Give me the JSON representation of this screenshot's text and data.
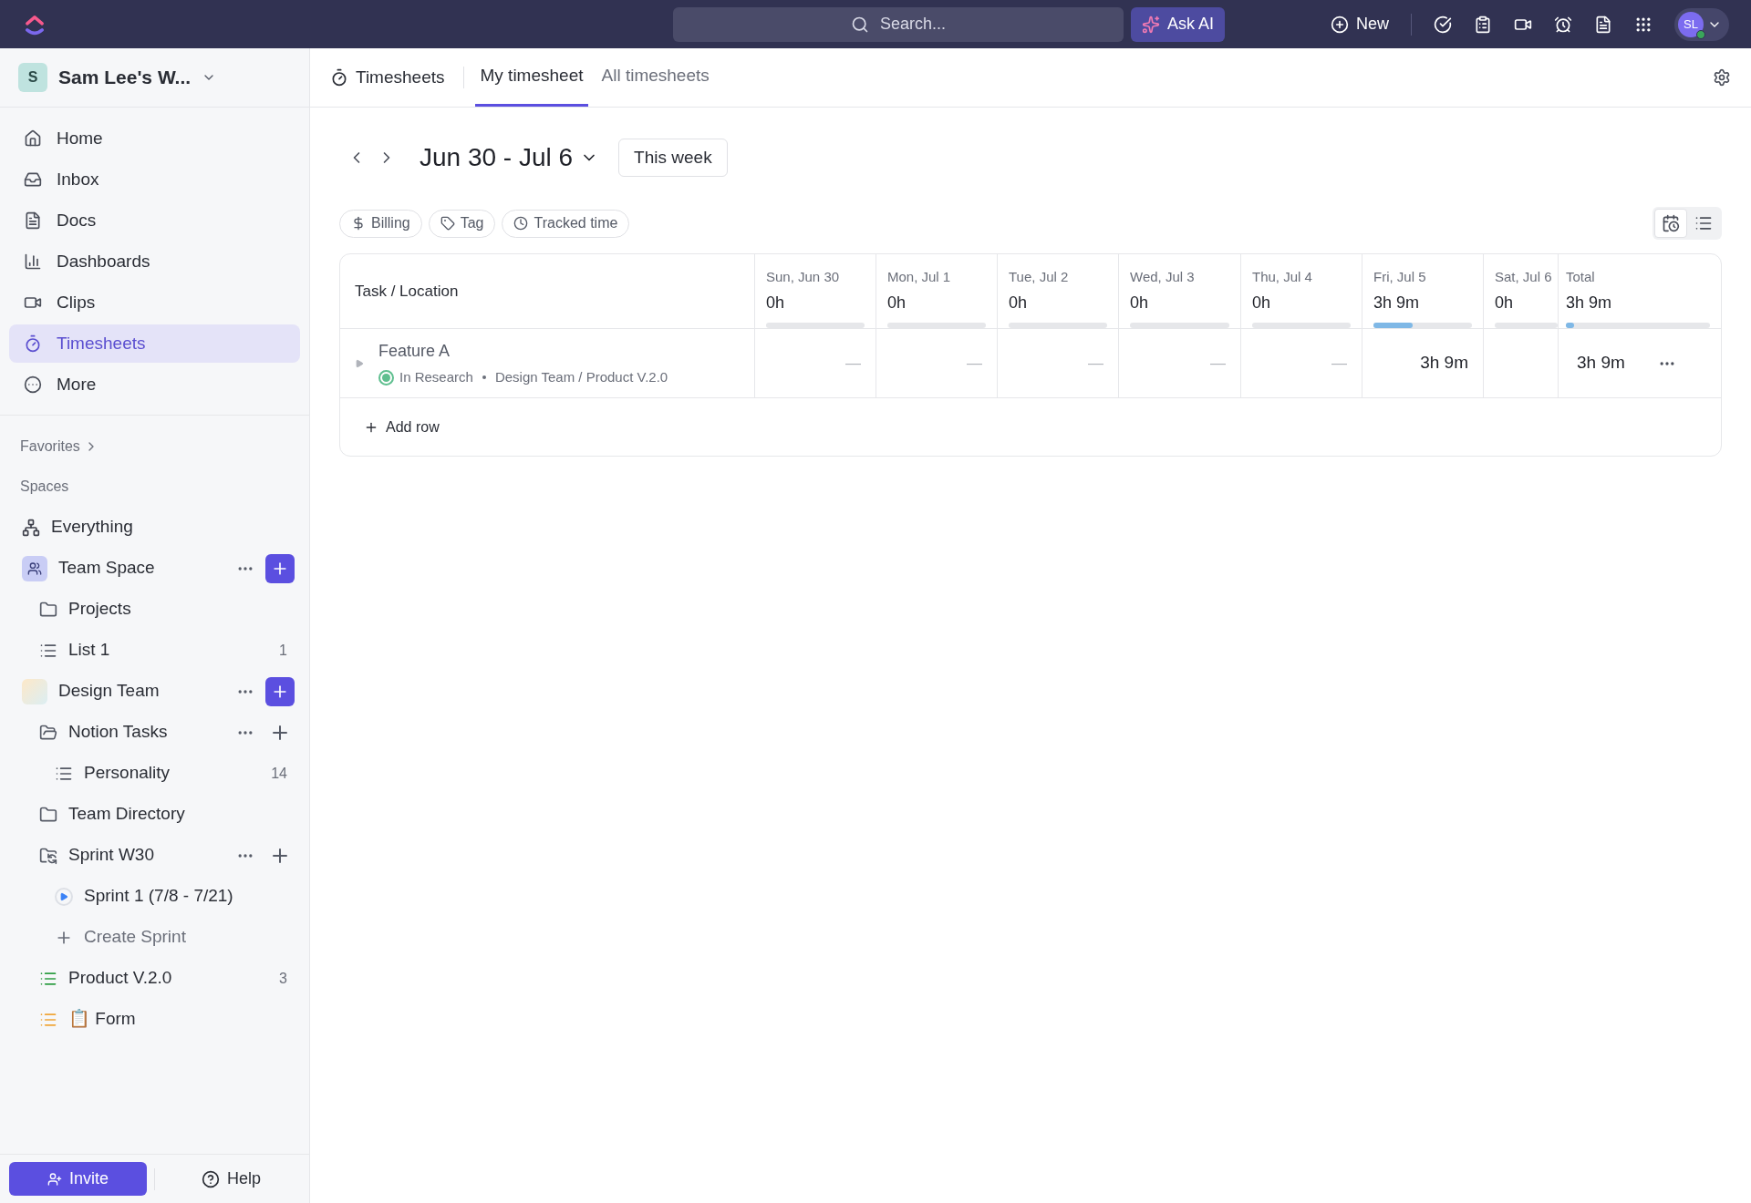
{
  "topbar": {
    "search": {
      "placeholder": "Search..."
    },
    "ask_ai": "Ask AI",
    "new": "New",
    "avatar": "SL"
  },
  "workspace": {
    "initial": "S",
    "name": "Sam Lee's W..."
  },
  "nav": [
    {
      "kind": "home",
      "label": "Home",
      "selected": false
    },
    {
      "kind": "inbox",
      "label": "Inbox",
      "selected": false
    },
    {
      "kind": "docs",
      "label": "Docs",
      "selected": false
    },
    {
      "kind": "dashboards",
      "label": "Dashboards",
      "selected": false
    },
    {
      "kind": "clips",
      "label": "Clips",
      "selected": false
    },
    {
      "kind": "timesheets",
      "label": "Timesheets",
      "selected": true
    },
    {
      "kind": "more",
      "label": "More",
      "selected": false
    }
  ],
  "favorites": "Favorites",
  "spaces_heading": "Spaces",
  "spaces": [
    {
      "kind": "everything",
      "label": "Everything"
    },
    {
      "kind": "space",
      "label": "Team Space",
      "children": [
        {
          "kind": "folder",
          "label": "Projects"
        },
        {
          "kind": "list",
          "label": "List 1",
          "count": "1"
        }
      ]
    },
    {
      "kind": "space_gradient",
      "label": "Design Team",
      "children": [
        {
          "kind": "folder_open",
          "label": "Notion Tasks",
          "children": [
            {
              "kind": "list",
              "label": "Personality",
              "count": "14"
            }
          ]
        },
        {
          "kind": "folder",
          "label": "Team Directory"
        },
        {
          "kind": "sprint_folder",
          "label": "Sprint W30",
          "children": [
            {
              "kind": "sprint",
              "label": "Sprint 1 (7/8 - 7/21)"
            },
            {
              "kind": "create",
              "label": "Create Sprint"
            }
          ]
        },
        {
          "kind": "list",
          "label": "Product V.2.0",
          "count": "3",
          "color": "#2f9e44"
        },
        {
          "kind": "list",
          "label": "📋 Form",
          "color": "#f0a73a"
        }
      ]
    }
  ],
  "footer": {
    "invite": "Invite",
    "help": "Help"
  },
  "header": {
    "title": "Timesheets",
    "tabs": [
      {
        "label": "My timesheet",
        "selected": true
      },
      {
        "label": "All timesheets",
        "selected": false
      }
    ]
  },
  "range": "Jun 30 - Jul 6",
  "this_week": "This week",
  "filters": [
    {
      "kind": "billing",
      "label": "Billing"
    },
    {
      "kind": "tag",
      "label": "Tag"
    },
    {
      "kind": "tracked",
      "label": "Tracked time"
    }
  ],
  "views": [
    {
      "kind": "timesheet",
      "selected": true
    },
    {
      "kind": "list",
      "selected": false
    }
  ],
  "table": {
    "task_header": "Task / Location",
    "days": [
      {
        "label": "Sun, Jun 30",
        "total": "0h",
        "level": 0
      },
      {
        "label": "Mon, Jul 1",
        "total": "0h",
        "level": 0
      },
      {
        "label": "Tue, Jul 2",
        "total": "0h",
        "level": 0
      },
      {
        "label": "Wed, Jul 3",
        "total": "0h",
        "level": 0
      },
      {
        "label": "Thu, Jul 4",
        "total": "0h",
        "level": 0
      },
      {
        "label": "Fri, Jul 5",
        "total": "3h 9m",
        "level": 0.4
      },
      {
        "label": "Sat, Jul 6",
        "total": "0h",
        "level": 0
      }
    ],
    "total": {
      "label": "Total",
      "value": "3h 9m",
      "level": 0.06
    },
    "rows": [
      {
        "task": "Feature A",
        "status": "In Research",
        "color": "#5fbf8f",
        "location": "Design Team / Product V.2.0",
        "cells": [
          "—",
          "—",
          "—",
          "—",
          "—",
          "3h 9m"
        ],
        "total": "3h 9m"
      }
    ],
    "add_row": "Add row"
  }
}
